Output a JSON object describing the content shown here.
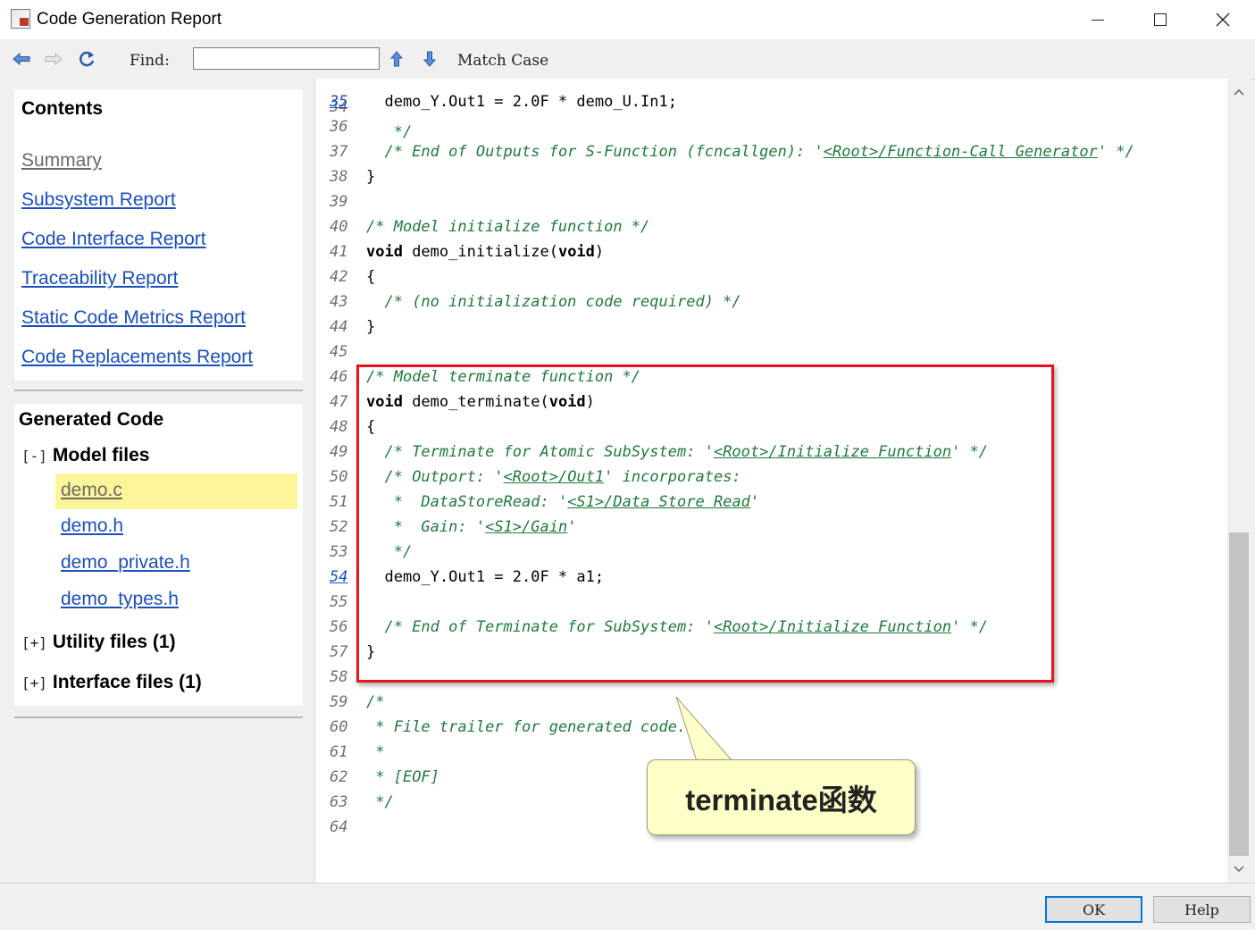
{
  "window": {
    "title": "Code Generation Report"
  },
  "toolbar": {
    "back_icon": "back-arrow-icon",
    "forward_icon": "forward-arrow-icon",
    "refresh_icon": "refresh-icon",
    "find_label": "Find:",
    "find_value": "",
    "find_up_icon": "arrow-up-icon",
    "find_down_icon": "arrow-down-icon",
    "match_case_label": "Match Case"
  },
  "contents": {
    "heading": "Contents",
    "links": [
      "Summary",
      "Subsystem Report",
      "Code Interface Report",
      "Traceability Report",
      "Static Code Metrics Report",
      "Code Replacements Report"
    ]
  },
  "generated_code": {
    "heading": "Generated Code",
    "model_files": {
      "toggle": "[-]",
      "label": "Model files",
      "files": [
        "demo.c",
        "demo.h",
        "demo_private.h",
        "demo_types.h"
      ],
      "selected": "demo.c"
    },
    "utility_files": {
      "toggle": "[+]",
      "label": "Utility files (1)"
    },
    "interface_files": {
      "toggle": "[+]",
      "label": "Interface files (1)"
    }
  },
  "code": {
    "partial_top_line": {
      "num": "34",
      "text": "   */"
    },
    "lines": [
      {
        "num": "35",
        "num_link": true,
        "segments": [
          {
            "t": "  demo_Y.Out1 = 2.0F * demo_U.In1;"
          }
        ]
      },
      {
        "num": "36",
        "segments": []
      },
      {
        "num": "37",
        "segments": [
          {
            "t": "  "
          },
          {
            "t": "/* End of Outputs for S-Function (fcncallgen): '",
            "c": "comment"
          },
          {
            "t": "<Root>/Function-Call Generator",
            "c": "clink"
          },
          {
            "t": "' */",
            "c": "comment"
          }
        ]
      },
      {
        "num": "38",
        "segments": [
          {
            "t": "}"
          }
        ]
      },
      {
        "num": "39",
        "segments": []
      },
      {
        "num": "40",
        "segments": [
          {
            "t": "/* Model initialize function */",
            "c": "comment"
          }
        ]
      },
      {
        "num": "41",
        "segments": [
          {
            "t": "void",
            "c": "kw"
          },
          {
            "t": " demo_initialize("
          },
          {
            "t": "void",
            "c": "kw"
          },
          {
            "t": ")"
          }
        ]
      },
      {
        "num": "42",
        "segments": [
          {
            "t": "{"
          }
        ]
      },
      {
        "num": "43",
        "segments": [
          {
            "t": "  "
          },
          {
            "t": "/* (no initialization code required) */",
            "c": "comment"
          }
        ]
      },
      {
        "num": "44",
        "segments": [
          {
            "t": "}"
          }
        ]
      },
      {
        "num": "45",
        "segments": []
      },
      {
        "num": "46",
        "segments": [
          {
            "t": "/* Model terminate function */",
            "c": "comment"
          }
        ]
      },
      {
        "num": "47",
        "segments": [
          {
            "t": "void",
            "c": "kw"
          },
          {
            "t": " demo_terminate("
          },
          {
            "t": "void",
            "c": "kw"
          },
          {
            "t": ")"
          }
        ]
      },
      {
        "num": "48",
        "segments": [
          {
            "t": "{"
          }
        ]
      },
      {
        "num": "49",
        "segments": [
          {
            "t": "  "
          },
          {
            "t": "/* Terminate for Atomic SubSystem: '",
            "c": "comment"
          },
          {
            "t": "<Root>/Initialize Function",
            "c": "clink"
          },
          {
            "t": "' */",
            "c": "comment"
          }
        ]
      },
      {
        "num": "50",
        "segments": [
          {
            "t": "  "
          },
          {
            "t": "/* Outport: '",
            "c": "comment"
          },
          {
            "t": "<Root>/Out1",
            "c": "clink"
          },
          {
            "t": "' incorporates:",
            "c": "comment"
          }
        ]
      },
      {
        "num": "51",
        "segments": [
          {
            "t": "   "
          },
          {
            "t": "*  DataStoreRead: '",
            "c": "comment"
          },
          {
            "t": "<S1>/Data Store Read",
            "c": "clink"
          },
          {
            "t": "'",
            "c": "comment"
          }
        ]
      },
      {
        "num": "52",
        "segments": [
          {
            "t": "   "
          },
          {
            "t": "*  Gain: '",
            "c": "comment"
          },
          {
            "t": "<S1>/Gain",
            "c": "clink"
          },
          {
            "t": "'",
            "c": "comment"
          }
        ]
      },
      {
        "num": "53",
        "segments": [
          {
            "t": "   "
          },
          {
            "t": "*/",
            "c": "comment"
          }
        ]
      },
      {
        "num": "54",
        "num_link": true,
        "segments": [
          {
            "t": "  demo_Y.Out1 = 2.0F * a1;"
          }
        ]
      },
      {
        "num": "55",
        "segments": []
      },
      {
        "num": "56",
        "segments": [
          {
            "t": "  "
          },
          {
            "t": "/* End of Terminate for SubSystem: '",
            "c": "comment"
          },
          {
            "t": "<Root>/Initialize Function",
            "c": "clink"
          },
          {
            "t": "' */",
            "c": "comment"
          }
        ]
      },
      {
        "num": "57",
        "segments": [
          {
            "t": "}"
          }
        ]
      },
      {
        "num": "58",
        "segments": []
      },
      {
        "num": "59",
        "segments": [
          {
            "t": "/*",
            "c": "comment"
          }
        ]
      },
      {
        "num": "60",
        "segments": [
          {
            "t": " "
          },
          {
            "t": "* File trailer for generated code.",
            "c": "comment"
          }
        ]
      },
      {
        "num": "61",
        "segments": [
          {
            "t": " "
          },
          {
            "t": "*",
            "c": "comment"
          }
        ]
      },
      {
        "num": "62",
        "segments": [
          {
            "t": " "
          },
          {
            "t": "* [EOF]",
            "c": "comment"
          }
        ]
      },
      {
        "num": "63",
        "segments": [
          {
            "t": " "
          },
          {
            "t": "*/",
            "c": "comment"
          }
        ]
      },
      {
        "num": "64",
        "segments": []
      }
    ]
  },
  "annotation": {
    "callout_text": "terminate函数"
  },
  "buttons": {
    "ok": "OK",
    "help": "Help"
  },
  "colors": {
    "link": "#1a4fbf",
    "comment": "#1f7a3c",
    "highlight_border": "#e8141c",
    "callout_bg": "#ffffc8",
    "selected_file_bg": "#fdf59a"
  }
}
